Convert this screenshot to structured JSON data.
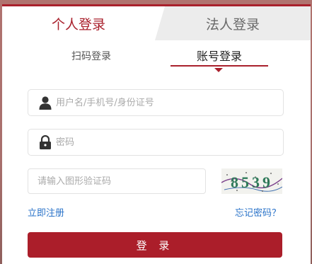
{
  "tabs": {
    "personal_label": "个人登录",
    "corporate_label": "法人登录"
  },
  "subtabs": {
    "qr_label": "扫码登录",
    "account_label": "账号登录"
  },
  "form": {
    "username_placeholder": "用户名/手机号/身份证号",
    "password_placeholder": "密码",
    "captcha_placeholder": "请输入图形验证码",
    "captcha_text": "8539"
  },
  "links": {
    "register": "立即注册",
    "forgot": "忘记密码？"
  },
  "login_button": "登 录",
  "colors": {
    "accent": "#a9202c",
    "link": "#2a73c9"
  }
}
